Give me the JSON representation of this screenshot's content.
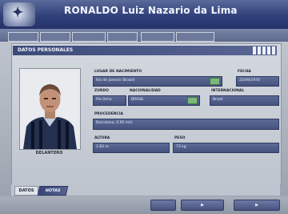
{
  "window": {
    "title": "RONALDO Luiz Nazario da Lima"
  },
  "tabs": [
    {
      "label": ""
    },
    {
      "label": ""
    },
    {
      "label": ""
    },
    {
      "label": ""
    },
    {
      "label": ""
    },
    {
      "label": ""
    }
  ],
  "panel": {
    "title": "DATOS PERSONALES"
  },
  "player": {
    "position_label": "DELANTERO"
  },
  "fields": {
    "birthplace": {
      "label": "LUGAR DE NACIMIENTO",
      "value": "Río de Janeiro (Brasil)",
      "badge": ""
    },
    "date": {
      "label": "FECHA",
      "value": "22/09/1976"
    },
    "foot": {
      "label": "ZURDO",
      "value": "Pie Dcho"
    },
    "nationality": {
      "label": "NACIONALIDAD",
      "value": "BRASIL",
      "badge": ""
    },
    "international": {
      "label": "INTERNACIONAL",
      "value": "Brasil"
    },
    "origin": {
      "label": "PROCEDENCIA",
      "value": "Barcelona, 0.00 mill."
    },
    "height": {
      "label": "ALTURA",
      "value": "1.83 m"
    },
    "weight": {
      "label": "PESO",
      "value": "73 kg"
    }
  },
  "subtabs": {
    "data": "DATOS",
    "notes": "NOTAS"
  },
  "footer": {
    "btn1": "",
    "btn2": "",
    "btn3": ""
  },
  "colors": {
    "title_bar": "#31407a",
    "field_bg": "#4f5c88",
    "accent_green": "#7cb87c"
  }
}
